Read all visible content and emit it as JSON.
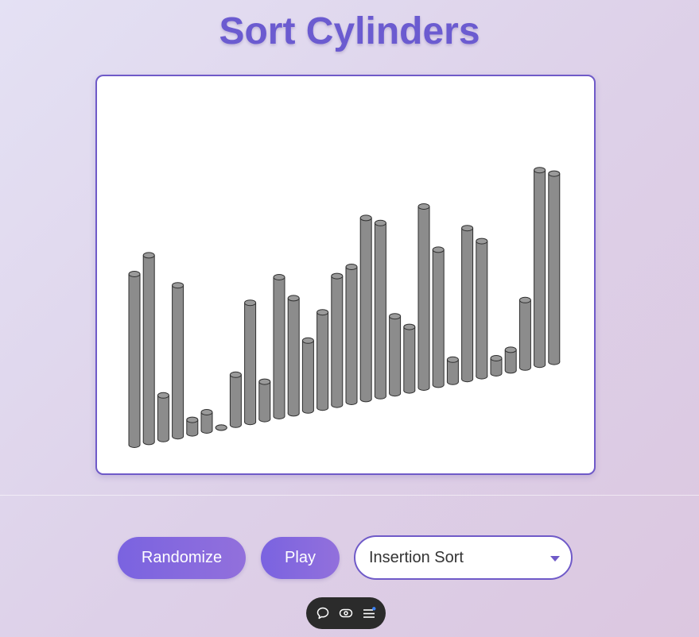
{
  "title": "Sort Cylinders",
  "controls": {
    "randomize_label": "Randomize",
    "play_label": "Play",
    "algorithm_selected": "Insertion Sort"
  },
  "bar_values": [
    215,
    235,
    55,
    190,
    17,
    23,
    0,
    63,
    150,
    47,
    175,
    145,
    88,
    120,
    162,
    170,
    228,
    218,
    97,
    80,
    228,
    170,
    28,
    190,
    170,
    19,
    26,
    85,
    245,
    237
  ],
  "colors": {
    "accent": "#6b5bd0",
    "cylinder": "#8c8c8c",
    "cylinder_stroke": "#2f2f2f",
    "toolbar_bg": "#2b2b2b",
    "notification_dot": "#3b82f6"
  },
  "toolbar_icons": [
    "comment-icon",
    "eye-icon",
    "menu-icon"
  ]
}
